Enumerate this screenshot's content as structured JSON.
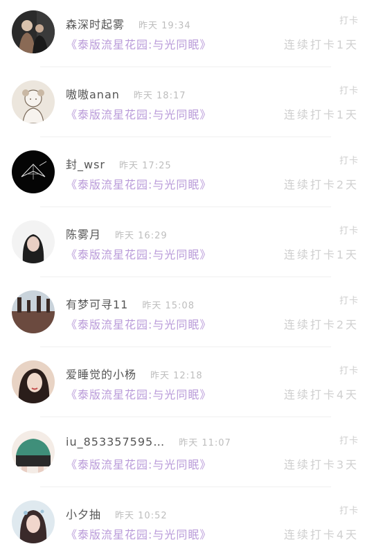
{
  "checkins": [
    {
      "name": "森深时起雾",
      "time": "昨天 19:34",
      "group": "《泰版流星花园:与光同眠》",
      "tag": "打卡",
      "streak": "连续打卡1天",
      "avatar_colors": [
        "#2b2b2b",
        "#8a6a55",
        "#d9c2ad"
      ]
    },
    {
      "name": "嗷嗷anan",
      "time": "昨天 18:17",
      "group": "《泰版流星花园:与光同眠》",
      "tag": "打卡",
      "streak": "连续打卡1天",
      "avatar_colors": [
        "#ece6dd",
        "#c9b8a4",
        "#7a6a5a"
      ]
    },
    {
      "name": "封_wsr",
      "time": "昨天 17:25",
      "group": "《泰版流星花园:与光同眠》",
      "tag": "打卡",
      "streak": "连续打卡2天",
      "avatar_colors": [
        "#050505",
        "#1a1a1a",
        "#e8e8e8"
      ]
    },
    {
      "name": "陈雾月",
      "time": "昨天 16:29",
      "group": "《泰版流星花园:与光同眠》",
      "tag": "打卡",
      "streak": "连续打卡1天",
      "avatar_colors": [
        "#f3f3f3",
        "#1e1e1e",
        "#e9cfc4"
      ]
    },
    {
      "name": "有梦可寻11",
      "time": "昨天 15:08",
      "group": "《泰版流星花园:与光同眠》",
      "tag": "打卡",
      "streak": "连续打卡2天",
      "avatar_colors": [
        "#6b4a3f",
        "#c9d3db",
        "#3a2a25"
      ]
    },
    {
      "name": "爱睡觉的小杨",
      "time": "昨天 12:18",
      "group": "《泰版流星花园:与光同眠》",
      "tag": "打卡",
      "streak": "连续打卡4天",
      "avatar_colors": [
        "#e8d3c4",
        "#2a1d1a",
        "#c24a4a"
      ]
    },
    {
      "name": "iu_853357595…",
      "time": "昨天 11:07",
      "group": "《泰版流星花园:与光同眠》",
      "tag": "打卡",
      "streak": "连续打卡3天",
      "avatar_colors": [
        "#f4ece6",
        "#3f8f7a",
        "#2a2a2a"
      ]
    },
    {
      "name": "小夕抽",
      "time": "昨天 10:52",
      "group": "《泰版流星花园:与光同眠》",
      "tag": "打卡",
      "streak": "连续打卡4天",
      "avatar_colors": [
        "#dfe9ef",
        "#3a2a2a",
        "#f1d6cc"
      ]
    }
  ]
}
